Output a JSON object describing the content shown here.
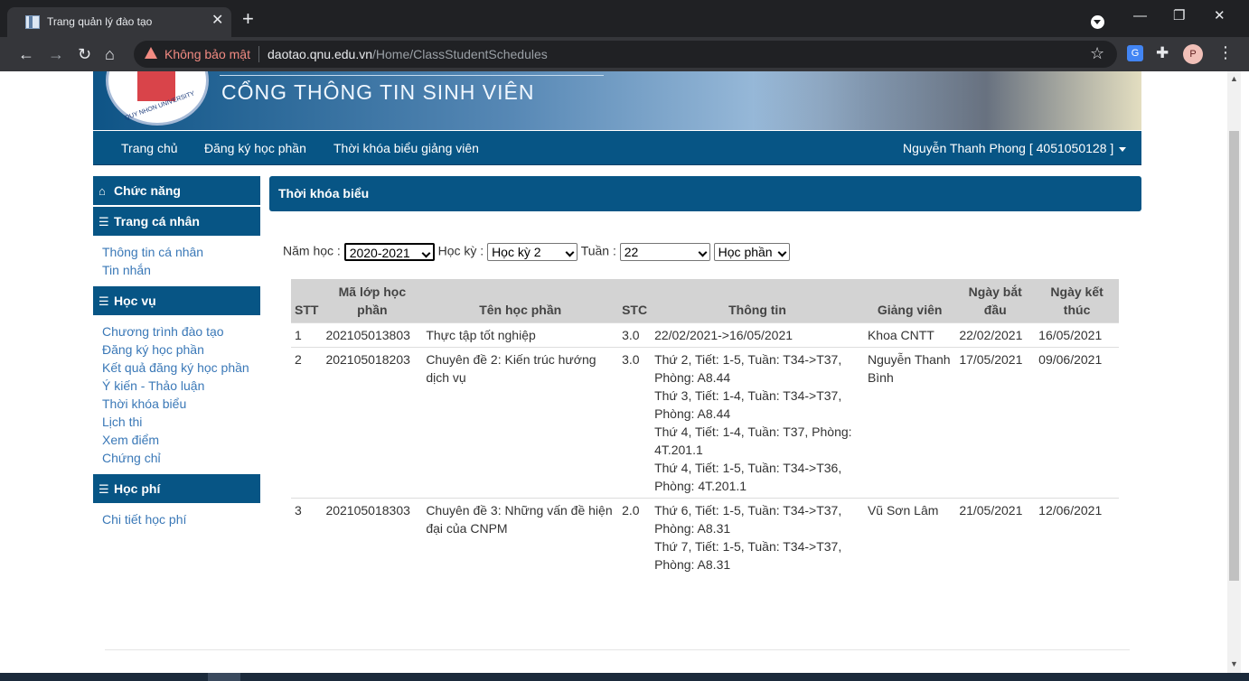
{
  "browser": {
    "tab_title": "Trang quản lý đào tạo",
    "tab_close": "✕",
    "new_tab": "+",
    "security_label": "Không bảo mật",
    "url_host": "daotao.qnu.edu.vn",
    "url_path": "/Home/ClassStudentSchedules",
    "profile_initial": "P"
  },
  "header": {
    "banner_title": "CỔNG THÔNG TIN SINH VIÊN",
    "logo_text": "QUY NHON UNIVERSITY"
  },
  "nav": {
    "items": [
      "Trang chủ",
      "Đăng ký học phần",
      "Thời khóa biểu giảng viên"
    ],
    "user": "Nguyễn Thanh Phong [ 4051050128 ]"
  },
  "sidebar": {
    "sections": [
      {
        "title": "Chức năng",
        "icon": "home-icon",
        "items": []
      },
      {
        "title": "Trang cá nhân",
        "icon": "list-icon",
        "items": [
          "Thông tin cá nhân",
          "Tin nhắn"
        ]
      },
      {
        "title": "Học vụ",
        "icon": "list-icon",
        "items": [
          "Chương trình đào tạo",
          "Đăng ký học phần",
          "Kết quả đăng ký học phần",
          "Ý kiến - Thảo luận",
          "Thời khóa biểu",
          "Lịch thi",
          "Xem điểm",
          "Chứng chỉ"
        ]
      },
      {
        "title": "Học phí",
        "icon": "list-icon",
        "items": [
          "Chi tiết học phí"
        ]
      }
    ]
  },
  "panel": {
    "title": "Thời khóa biểu"
  },
  "filters": {
    "year_label": "Năm học :",
    "year_value": "2020-2021",
    "semester_label": "Học kỳ :",
    "semester_value": "Học kỳ 2",
    "week_label": "Tuần :",
    "week_value": "22",
    "course_value": "Học phần"
  },
  "table": {
    "headers": [
      "STT",
      "Mã lớp học phần",
      "Tên học phần",
      "STC",
      "Thông tin",
      "Giảng viên",
      "Ngày bắt đầu",
      "Ngày kết thúc"
    ],
    "rows": [
      {
        "stt": "1",
        "code": "202105013803",
        "name": "Thực tập tốt nghiệp",
        "stc": "3.0",
        "info": [
          "22/02/2021->16/05/2021"
        ],
        "lecturer": "Khoa CNTT",
        "start": "22/02/2021",
        "end": "16/05/2021"
      },
      {
        "stt": "2",
        "code": "202105018203",
        "name": "Chuyên đề 2: Kiến trúc hướng dịch vụ",
        "stc": "3.0",
        "info": [
          "Thứ 2, Tiết: 1-5, Tuần: T34->T37, Phòng: A8.44",
          "Thứ 3, Tiết: 1-4, Tuần: T34->T37, Phòng: A8.44",
          "Thứ 4, Tiết: 1-4, Tuần: T37, Phòng: 4T.201.1",
          "Thứ 4, Tiết: 1-5, Tuần: T34->T36, Phòng: 4T.201.1"
        ],
        "lecturer": "Nguyễn Thanh Bình",
        "start": "17/05/2021",
        "end": "09/06/2021"
      },
      {
        "stt": "3",
        "code": "202105018303",
        "name": "Chuyên đề 3: Những vấn đề hiện đại của CNPM",
        "stc": "2.0",
        "info": [
          "Thứ 6, Tiết: 1-5, Tuần: T34->T37, Phòng: A8.31",
          "Thứ 7, Tiết: 1-5, Tuần: T34->T37, Phòng: A8.31"
        ],
        "lecturer": "Vũ Sơn Lâm",
        "start": "21/05/2021",
        "end": "12/06/2021"
      }
    ]
  },
  "colors": {
    "primary": "#075585",
    "link": "#3a78b7",
    "header_bg": "#d3d3d3"
  }
}
